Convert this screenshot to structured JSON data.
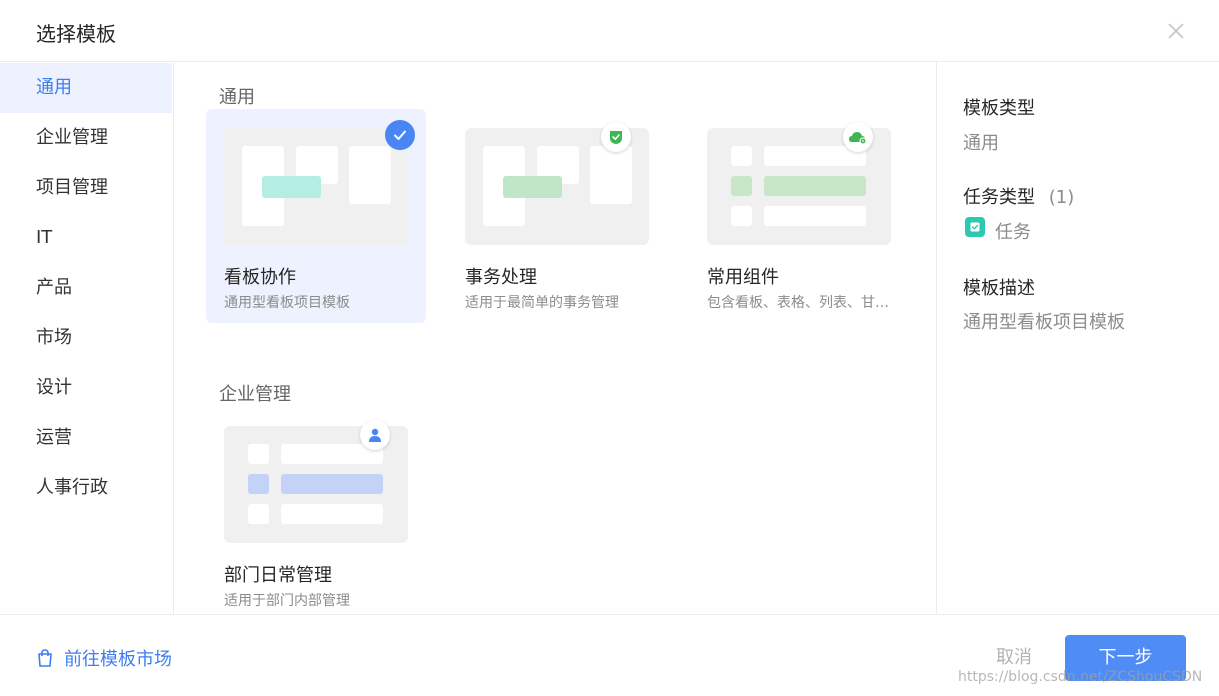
{
  "dialog": {
    "title": "选择模板"
  },
  "icons": {
    "close": "close-icon",
    "check": "check-icon",
    "shield": "shield-check-icon",
    "cloud": "cloud-gear-icon",
    "user": "user-icon",
    "bag": "shopping-bag-icon",
    "task": "task-icon"
  },
  "colors": {
    "accent": "#3f7ef0",
    "selected_bg": "#edf2fe",
    "task_teal": "#2ec7b4"
  },
  "sidebar": {
    "items": [
      {
        "label": "通用",
        "active": true
      },
      {
        "label": "企业管理"
      },
      {
        "label": "项目管理"
      },
      {
        "label": "IT"
      },
      {
        "label": "产品"
      },
      {
        "label": "市场"
      },
      {
        "label": "设计"
      },
      {
        "label": "运营"
      },
      {
        "label": "人事行政"
      }
    ]
  },
  "sections": [
    {
      "title": "通用",
      "cards": [
        {
          "name": "看板协作",
          "desc": "通用型看板项目模板",
          "selected": true
        },
        {
          "name": "事务处理",
          "desc": "适用于最简单的事务管理"
        },
        {
          "name": "常用组件",
          "desc": "包含看板、表格、列表、甘特图等常用组件"
        }
      ]
    },
    {
      "title": "企业管理",
      "cards": [
        {
          "name": "部门日常管理",
          "desc": "适用于部门内部管理"
        }
      ]
    }
  ],
  "detail": {
    "template_type_label": "模板类型",
    "template_type_value": "通用",
    "task_type_label": "任务类型",
    "task_type_count": "(1)",
    "task_item": "任务",
    "desc_label": "模板描述",
    "desc_value": "通用型看板项目模板"
  },
  "footer": {
    "market_link": "前往模板市场",
    "cancel": "取消",
    "next": "下一步"
  },
  "watermark": "https://blog.csdn.net/ZCShouCSDN"
}
